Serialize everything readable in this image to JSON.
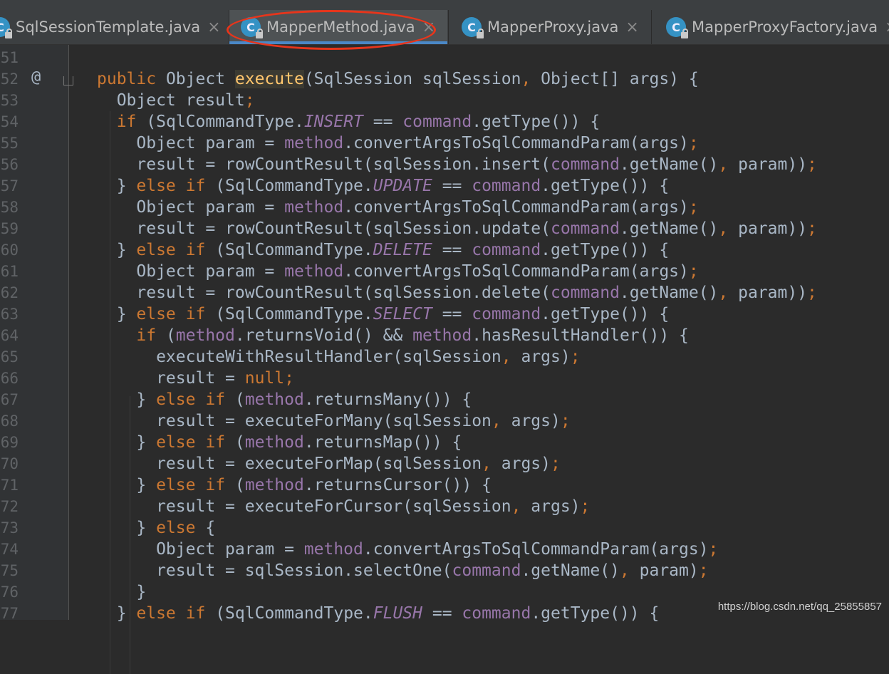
{
  "tabs": [
    {
      "label": "SqlSessionTemplate.java",
      "icon": "class-icon",
      "active": false
    },
    {
      "label": "MapperMethod.java",
      "icon": "class-icon",
      "active": true
    },
    {
      "label": "MapperProxy.java",
      "icon": "class-icon",
      "active": false
    },
    {
      "label": "MapperProxyFactory.java",
      "icon": "class-icon",
      "active": false
    }
  ],
  "tab_icon_letter": "C",
  "close_glyph": "×",
  "gutter": {
    "line_numbers": [
      "51",
      "52",
      "53",
      "54",
      "55",
      "56",
      "57",
      "58",
      "59",
      "60",
      "61",
      "62",
      "63",
      "64",
      "65",
      "66",
      "67",
      "68",
      "69",
      "70",
      "71",
      "72",
      "73",
      "74",
      "75",
      "76",
      "77"
    ],
    "annotation_glyph": "@"
  },
  "code_lines": [
    "",
    "public Object execute(SqlSession sqlSession, Object[] args) {",
    "  Object result;",
    "  if (SqlCommandType.INSERT == command.getType()) {",
    "    Object param = method.convertArgsToSqlCommandParam(args);",
    "    result = rowCountResult(sqlSession.insert(command.getName(), param));",
    "  } else if (SqlCommandType.UPDATE == command.getType()) {",
    "    Object param = method.convertArgsToSqlCommandParam(args);",
    "    result = rowCountResult(sqlSession.update(command.getName(), param));",
    "  } else if (SqlCommandType.DELETE == command.getType()) {",
    "    Object param = method.convertArgsToSqlCommandParam(args);",
    "    result = rowCountResult(sqlSession.delete(command.getName(), param));",
    "  } else if (SqlCommandType.SELECT == command.getType()) {",
    "    if (method.returnsVoid() && method.hasResultHandler()) {",
    "      executeWithResultHandler(sqlSession, args);",
    "      result = null;",
    "    } else if (method.returnsMany()) {",
    "      result = executeForMany(sqlSession, args);",
    "    } else if (method.returnsMap()) {",
    "      result = executeForMap(sqlSession, args);",
    "    } else if (method.returnsCursor()) {",
    "      result = executeForCursor(sqlSession, args);",
    "    } else {",
    "      Object param = method.convertArgsToSqlCommandParam(args);",
    "      result = sqlSession.selectOne(command.getName(), param);",
    "    }",
    "  } else if (SqlCommandType.FLUSH == command.getType()) {"
  ],
  "highlighted_method": "execute",
  "watermark": "https://blog.csdn.net/qq_25855857",
  "colors": {
    "background": "#2b2b2b",
    "keyword": "#cc7832",
    "field": "#9876aa",
    "text": "#a9b7c6",
    "annotation_oval": "#e8351b",
    "active_tab_underline": "#4a88c7"
  }
}
